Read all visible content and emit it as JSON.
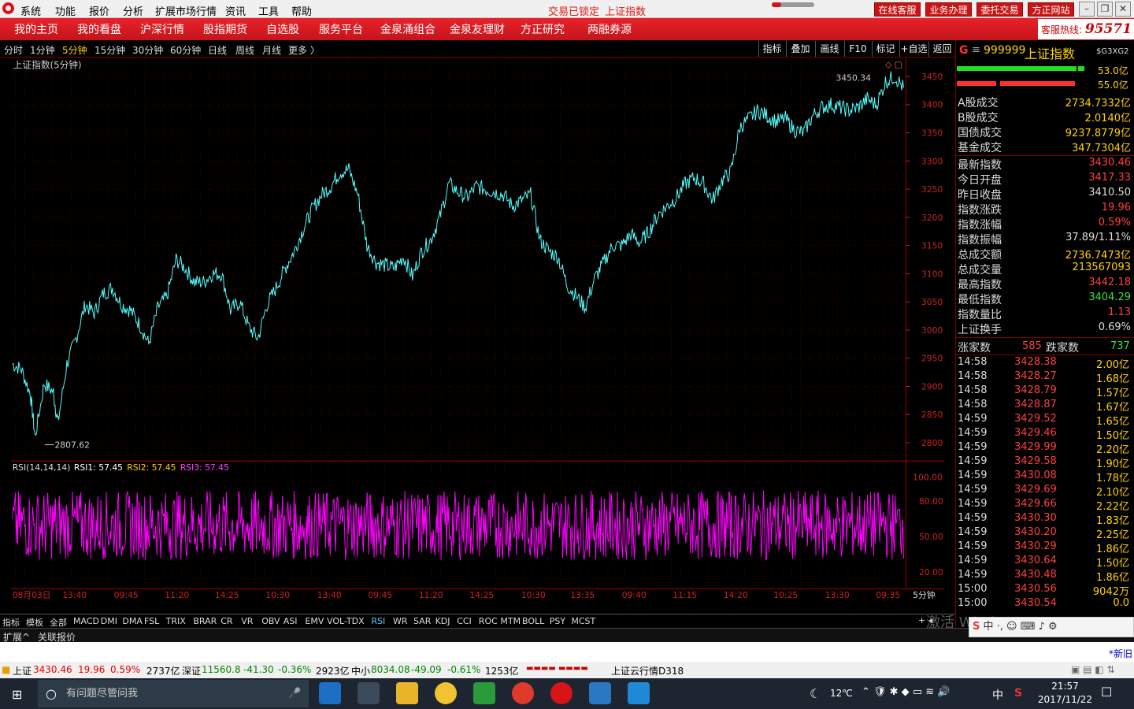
{
  "menubar": {
    "items": [
      "系统",
      "功能",
      "报价",
      "分析",
      "扩展市场行情",
      "资讯",
      "工具",
      "帮助"
    ],
    "status_left": "交易已锁定",
    "status_right": "上证指数",
    "buttons": [
      "在线客服",
      "业务办理",
      "委托交易",
      "方正网站"
    ]
  },
  "navbar": {
    "items": [
      "我的主页",
      "我的看盘",
      "沪深行情",
      "股指期货",
      "自选股",
      "服务平台",
      "金泉涌组合",
      "金泉友理财",
      "方正研究",
      "两融券源"
    ],
    "hotline_label": "客服热线:",
    "hotline_num": "95571"
  },
  "periods": {
    "items": [
      "分时",
      "1分钟",
      "5分钟",
      "15分钟",
      "30分钟",
      "60分钟",
      "日线",
      "周线",
      "月线",
      "更多 〉"
    ],
    "selected": "5分钟"
  },
  "right_buttons": [
    "指标",
    "叠加",
    "画线",
    "F10",
    "标记",
    "+自选",
    "返回"
  ],
  "chart": {
    "title": "上证指数(5分钟)",
    "high_label": "3450.34",
    "low_label": "2807.62",
    "rsi_label": "RSI(14,14,14)",
    "rsi1_label": "RSI1: 57.45",
    "rsi2_label": "RSI2: 57.45",
    "rsi3_label": "RSI3: 57.45",
    "time_labels": [
      "08月03日",
      "13:40",
      "09:45",
      "11:20",
      "14:25",
      "10:30",
      "13:40",
      "09:45",
      "11:20",
      "14:25",
      "10:30",
      "13:35",
      "09:40",
      "11:15",
      "14:20",
      "10:25",
      "13:30",
      "09:35"
    ],
    "period_label": "5分钟"
  },
  "chart_data": {
    "type": "line",
    "title": "上证指数(5分钟)",
    "y_ticks": [
      "3450",
      "3400",
      "3350",
      "3300",
      "3250",
      "3200",
      "3150",
      "3100",
      "3050",
      "3000",
      "2950",
      "2900",
      "2850",
      "2800"
    ],
    "ylim": [
      2780,
      3470
    ],
    "series": [
      {
        "name": "上证指数",
        "points": [
          [
            0,
            2940
          ],
          [
            2,
            2930
          ],
          [
            4,
            2885
          ],
          [
            5,
            2810
          ],
          [
            7,
            2905
          ],
          [
            9,
            2890
          ],
          [
            10,
            2835
          ],
          [
            12,
            2940
          ],
          [
            14,
            2985
          ],
          [
            16,
            3045
          ],
          [
            18,
            3030
          ],
          [
            20,
            3065
          ],
          [
            22,
            3075
          ],
          [
            24,
            3045
          ],
          [
            26,
            3035
          ],
          [
            28,
            3010
          ],
          [
            30,
            2975
          ],
          [
            32,
            3040
          ],
          [
            34,
            3060
          ],
          [
            36,
            3125
          ],
          [
            38,
            3110
          ],
          [
            40,
            3085
          ],
          [
            42,
            3085
          ],
          [
            44,
            3100
          ],
          [
            46,
            3100
          ],
          [
            48,
            3035
          ],
          [
            50,
            3050
          ],
          [
            52,
            3005
          ],
          [
            54,
            2985
          ],
          [
            56,
            3045
          ],
          [
            58,
            3075
          ],
          [
            60,
            3110
          ],
          [
            62,
            3140
          ],
          [
            64,
            3180
          ],
          [
            66,
            3215
          ],
          [
            68,
            3240
          ],
          [
            70,
            3255
          ],
          [
            72,
            3280
          ],
          [
            74,
            3285
          ],
          [
            76,
            3240
          ],
          [
            78,
            3150
          ],
          [
            80,
            3120
          ],
          [
            82,
            3115
          ],
          [
            84,
            3110
          ],
          [
            86,
            3130
          ],
          [
            88,
            3095
          ],
          [
            90,
            3140
          ],
          [
            92,
            3160
          ],
          [
            94,
            3200
          ],
          [
            96,
            3260
          ],
          [
            98,
            3245
          ],
          [
            100,
            3235
          ],
          [
            102,
            3255
          ],
          [
            104,
            3250
          ],
          [
            106,
            3245
          ],
          [
            108,
            3240
          ],
          [
            110,
            3220
          ],
          [
            112,
            3230
          ],
          [
            114,
            3240
          ],
          [
            116,
            3160
          ],
          [
            118,
            3140
          ],
          [
            120,
            3130
          ],
          [
            122,
            3080
          ],
          [
            124,
            3060
          ],
          [
            126,
            3040
          ],
          [
            128,
            3090
          ],
          [
            130,
            3120
          ],
          [
            132,
            3150
          ],
          [
            134,
            3150
          ],
          [
            136,
            3170
          ],
          [
            138,
            3155
          ],
          [
            140,
            3175
          ],
          [
            142,
            3205
          ],
          [
            144,
            3220
          ],
          [
            146,
            3235
          ],
          [
            148,
            3260
          ],
          [
            150,
            3270
          ],
          [
            152,
            3260
          ],
          [
            154,
            3230
          ],
          [
            156,
            3265
          ],
          [
            158,
            3280
          ],
          [
            160,
            3360
          ],
          [
            162,
            3375
          ],
          [
            164,
            3390
          ],
          [
            166,
            3380
          ],
          [
            168,
            3370
          ],
          [
            170,
            3375
          ],
          [
            172,
            3355
          ],
          [
            174,
            3350
          ],
          [
            176,
            3380
          ],
          [
            178,
            3395
          ],
          [
            180,
            3400
          ],
          [
            182,
            3395
          ],
          [
            184,
            3390
          ],
          [
            186,
            3395
          ],
          [
            188,
            3410
          ],
          [
            190,
            3400
          ],
          [
            192,
            3440
          ],
          [
            194,
            3450
          ],
          [
            196,
            3430
          ]
        ]
      }
    ]
  },
  "quote": {
    "code": "999999",
    "name": "上证指数",
    "tag": "$G3XG2",
    "bar1": "53.0亿",
    "bar2": "55.0亿",
    "turnover": [
      {
        "k": "A股成交",
        "v": "2734.7332亿"
      },
      {
        "k": "B股成交",
        "v": "2.0140亿"
      },
      {
        "k": "国债成交",
        "v": "9237.8779亿"
      },
      {
        "k": "基金成交",
        "v": "347.7304亿"
      }
    ],
    "stats": [
      {
        "k": "最新指数",
        "v": "3430.46",
        "c": "#ff4040"
      },
      {
        "k": "今日开盘",
        "v": "3417.33",
        "c": "#ff4040"
      },
      {
        "k": "昨日收盘",
        "v": "3410.50",
        "c": "#dddddd"
      },
      {
        "k": "指数涨跌",
        "v": "19.96",
        "c": "#ff4040"
      },
      {
        "k": "指数涨幅",
        "v": "0.59%",
        "c": "#ff4040"
      },
      {
        "k": "指数振幅",
        "v": "37.89/1.11%",
        "c": "#dddddd"
      },
      {
        "k": "总成交额",
        "v": "2736.7473亿",
        "c": "#ffd200"
      },
      {
        "k": "总成交量",
        "v": "213567093",
        "c": "#ffd200"
      },
      {
        "k": "最高指数",
        "v": "3442.18",
        "c": "#ff4040"
      },
      {
        "k": "最低指数",
        "v": "3404.29",
        "c": "#3ce03c"
      },
      {
        "k": "指数量比",
        "v": "1.13",
        "c": "#ff4040"
      },
      {
        "k": "上证换手",
        "v": "0.69%",
        "c": "#dddddd"
      }
    ],
    "up_label": "涨家数",
    "up": "585",
    "down_label": "跌家数",
    "down": "737",
    "ticks": [
      {
        "t": "14:58",
        "p": "3428.38",
        "v": "2.00亿"
      },
      {
        "t": "14:58",
        "p": "3428.27",
        "v": "1.68亿"
      },
      {
        "t": "14:58",
        "p": "3428.79",
        "v": "1.57亿"
      },
      {
        "t": "14:58",
        "p": "3428.87",
        "v": "1.67亿"
      },
      {
        "t": "14:59",
        "p": "3429.52",
        "v": "1.65亿"
      },
      {
        "t": "14:59",
        "p": "3429.46",
        "v": "1.50亿"
      },
      {
        "t": "14:59",
        "p": "3429.99",
        "v": "2.20亿"
      },
      {
        "t": "14:59",
        "p": "3429.58",
        "v": "1.90亿"
      },
      {
        "t": "14:59",
        "p": "3430.08",
        "v": "1.78亿"
      },
      {
        "t": "14:59",
        "p": "3429.69",
        "v": "2.10亿"
      },
      {
        "t": "14:59",
        "p": "3429.66",
        "v": "2.22亿"
      },
      {
        "t": "14:59",
        "p": "3430.30",
        "v": "1.83亿"
      },
      {
        "t": "14:59",
        "p": "3430.20",
        "v": "2.25亿"
      },
      {
        "t": "14:59",
        "p": "3430.29",
        "v": "1.86亿"
      },
      {
        "t": "14:59",
        "p": "3430.64",
        "v": "1.50亿"
      },
      {
        "t": "14:59",
        "p": "3430.48",
        "v": "1.86亿"
      },
      {
        "t": "15:00",
        "p": "3430.56",
        "v": "9042万"
      },
      {
        "t": "15:00",
        "p": "3430.54",
        "v": "0.0"
      }
    ]
  },
  "indicator_tabs": [
    "指标",
    "模板",
    "全部",
    "MACD",
    "DMI",
    "DMA",
    "FSL",
    "TRIX",
    "BRAR",
    "CR",
    "VR",
    "OBV",
    "ASI",
    "EMV",
    "VOL-TDX",
    "RSI",
    "WR",
    "SAR",
    "KDJ",
    "CCI",
    "ROC",
    "MTM",
    "BOLL",
    "PSY",
    "MCST"
  ],
  "indicator_selected": "RSI",
  "bottom_tabs": [
    "扩展^",
    "关联报价"
  ],
  "newinfo": "*新旧",
  "ticker": {
    "sh": "上证",
    "sh_v": "3430.46",
    "sh_c": "19.96",
    "sh_p": "0.59%",
    "sh_a": "2737亿",
    "sz": "深证",
    "sz_v": "11560.8",
    "sz_c": "-41.30",
    "sz_p": "-0.36%",
    "sz_a": "2923亿",
    "zx": "中小",
    "zx_v": "8034.08",
    "zx_c": "-49.09",
    "zx_p": "-0.61%",
    "zx_a": "1253亿",
    "cloud": "上证云行情D318"
  },
  "taskbar": {
    "search_placeholder": "有问题尽管问我",
    "temp": "12℃",
    "ime": "中",
    "time": "21:57",
    "date": "2017/11/22"
  },
  "watermark": "激活 Windows"
}
